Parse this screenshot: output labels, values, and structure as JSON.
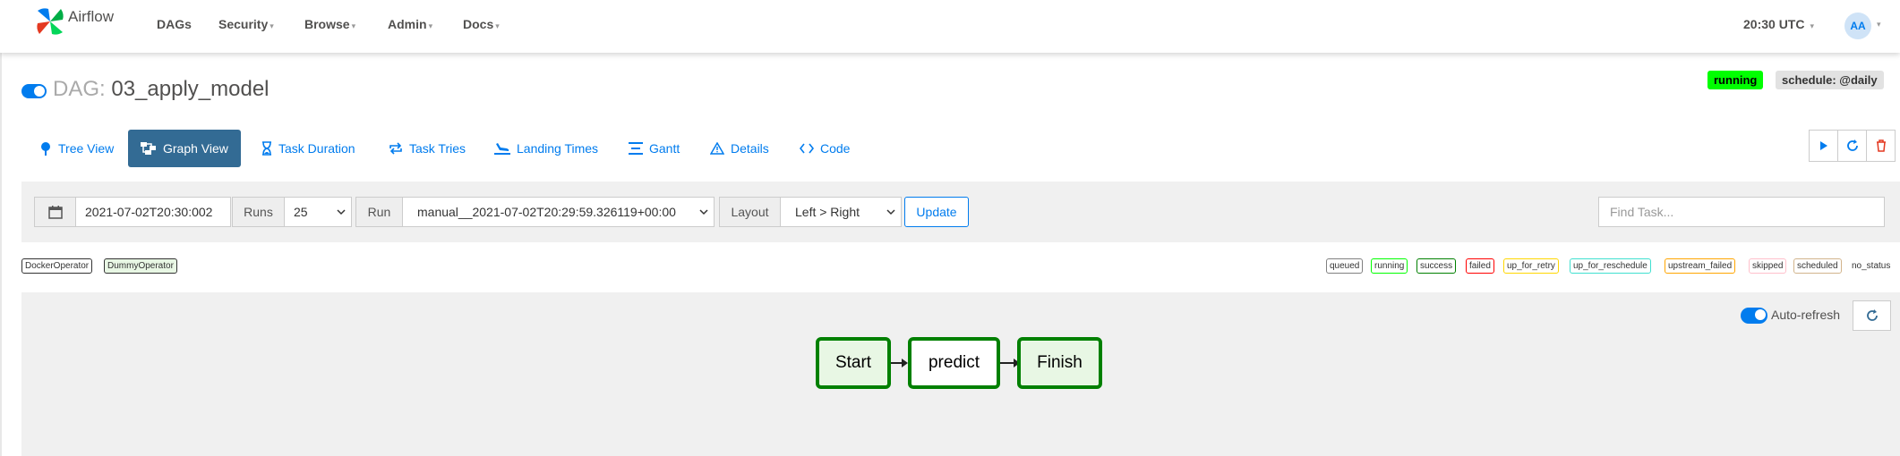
{
  "app": {
    "name": "Airflow"
  },
  "nav": {
    "items": [
      {
        "label": "DAGs",
        "dropdown": false
      },
      {
        "label": "Security",
        "dropdown": true
      },
      {
        "label": "Browse",
        "dropdown": true
      },
      {
        "label": "Admin",
        "dropdown": true
      },
      {
        "label": "Docs",
        "dropdown": true
      }
    ],
    "clock": "20:30 UTC",
    "user_initials": "AA"
  },
  "dag": {
    "prefix": "DAG:",
    "id": "03_apply_model",
    "state_badge": "running",
    "schedule_badge": "schedule: @daily"
  },
  "tabs": [
    {
      "label": "Tree View",
      "icon": "tree-icon",
      "active": false
    },
    {
      "label": "Graph View",
      "icon": "graph-icon",
      "active": true
    },
    {
      "label": "Task Duration",
      "icon": "hourglass-icon",
      "active": false
    },
    {
      "label": "Task Tries",
      "icon": "repeat-icon",
      "active": false
    },
    {
      "label": "Landing Times",
      "icon": "landing-icon",
      "active": false
    },
    {
      "label": "Gantt",
      "icon": "gantt-icon",
      "active": false
    },
    {
      "label": "Details",
      "icon": "warning-icon",
      "active": false
    },
    {
      "label": "Code",
      "icon": "code-icon",
      "active": false
    }
  ],
  "actions": {
    "trigger_icon": "play-icon",
    "refresh_icon": "refresh-icon",
    "delete_icon": "trash-icon"
  },
  "filters": {
    "base_date": "2021-07-02T20:30:002",
    "runs_label": "Runs",
    "runs_value": "25",
    "run_label": "Run",
    "run_value": "manual__2021-07-02T20:29:59.326119+00:00",
    "layout_label": "Layout",
    "layout_value": "Left > Right",
    "update_label": "Update",
    "find_placeholder": "Find Task..."
  },
  "operators": [
    {
      "label": "DockerOperator",
      "color": "#ffffff"
    },
    {
      "label": "DummyOperator",
      "color": "#e8f7e4"
    }
  ],
  "states": [
    {
      "label": "queued",
      "color": "#808080"
    },
    {
      "label": "running",
      "color": "#00ff00"
    },
    {
      "label": "success",
      "color": "#008000"
    },
    {
      "label": "failed",
      "color": "#ff0000"
    },
    {
      "label": "up_for_retry",
      "color": "#ffd700"
    },
    {
      "label": "up_for_reschedule",
      "color": "#40e0d0"
    },
    {
      "label": "upstream_failed",
      "color": "#ffa500"
    },
    {
      "label": "skipped",
      "color": "#ffc0cb"
    },
    {
      "label": "scheduled",
      "color": "#d2b48c"
    },
    {
      "label": "no_status",
      "color": ""
    }
  ],
  "graph": {
    "auto_refresh_label": "Auto-refresh",
    "nodes": [
      {
        "label": "Start",
        "fill": "#e8f7e4"
      },
      {
        "label": "predict",
        "fill": "#ffffff"
      },
      {
        "label": "Finish",
        "fill": "#e8f7e4"
      }
    ]
  }
}
